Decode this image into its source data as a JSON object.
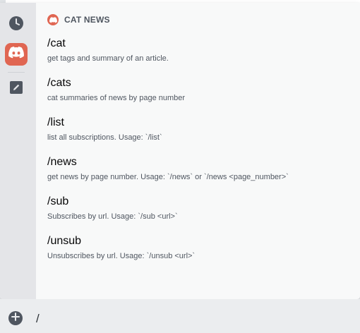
{
  "header": {
    "app_name": "CAT NEWS"
  },
  "rail": [
    {
      "icon": "clock-icon"
    },
    {
      "icon": "discord-icon",
      "active": true
    },
    {
      "icon": "edit-icon"
    }
  ],
  "commands": [
    {
      "name": "/cat",
      "description": "get tags and summary of an article."
    },
    {
      "name": "/cats",
      "description": "cat summaries of news by page number"
    },
    {
      "name": "/list",
      "description": "list all subscriptions. Usage: `/list`"
    },
    {
      "name": "/news",
      "description": "get news by page number. Usage: `/news` or `/news <page_number>`"
    },
    {
      "name": "/sub",
      "description": "Subscribes by url. Usage: `/sub <url>`"
    },
    {
      "name": "/unsub",
      "description": "Unsubscribes by url. Usage: `/unsub <url>`"
    }
  ],
  "composer": {
    "value": "/"
  },
  "colors": {
    "accent": "#e06652",
    "rail_bg": "#e4e5e8",
    "popup_bg": "#f8f9f9"
  }
}
